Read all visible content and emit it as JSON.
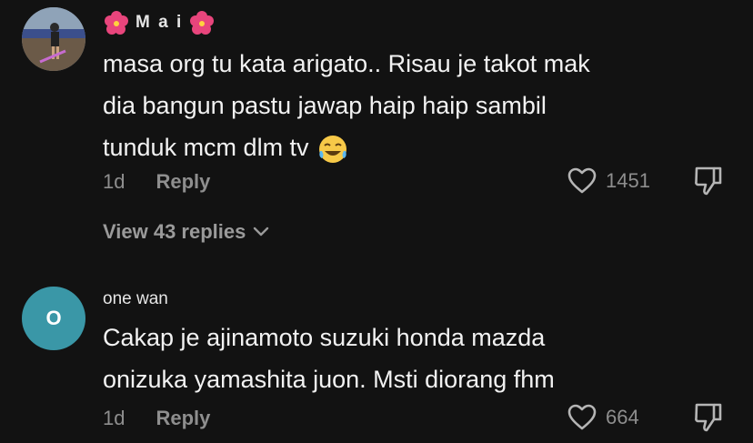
{
  "comments": [
    {
      "username": "M a i",
      "lines": [
        "masa org tu kata arigato.. Risau je takot mak",
        "dia bangun pastu jawap haip haip sambil",
        "tunduk mcm dlm tv"
      ],
      "time": "1d",
      "reply_label": "Reply",
      "likes": "1451",
      "view_replies": "View 43 replies"
    },
    {
      "avatar_letter": "O",
      "username": "one wan",
      "lines": [
        "Cakap je ajinamoto suzuki honda mazda",
        "onizuka yamashita juon. Msti diorang fhm"
      ],
      "time": "1d",
      "reply_label": "Reply",
      "likes": "664"
    }
  ],
  "colors": {
    "background": "#121212",
    "secondary_text": "#8e8e8e",
    "avatar_teal": "#3a97a7",
    "flower_pink": "#e8457c"
  },
  "icons": {
    "username_decoration": "hibiscus-icon",
    "like": "heart-outline-icon",
    "dislike": "thumbs-down-icon",
    "emoji": "tears-of-joy-icon"
  }
}
